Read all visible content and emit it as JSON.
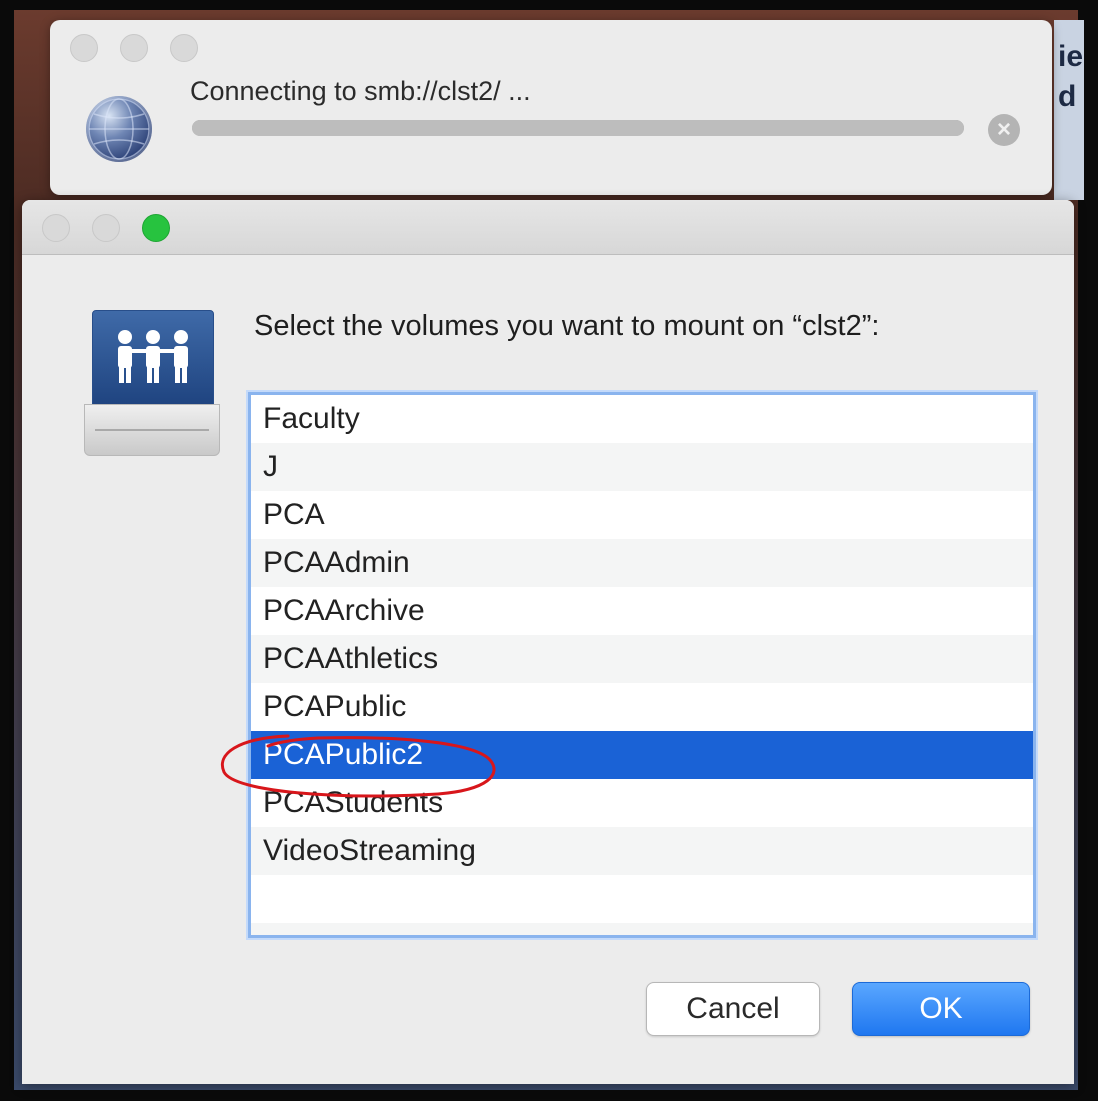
{
  "connect_window": {
    "status_text": "Connecting to smb://clst2/ ...",
    "progress": 1.0
  },
  "background": {
    "letters": [
      "ie",
      "d"
    ]
  },
  "dialog": {
    "prompt": "Select the volumes you want to mount on “clst2”:",
    "volumes": [
      {
        "label": "Faculty",
        "selected": false
      },
      {
        "label": "J",
        "selected": false
      },
      {
        "label": "PCA",
        "selected": false
      },
      {
        "label": "PCAAdmin",
        "selected": false
      },
      {
        "label": "PCAArchive",
        "selected": false
      },
      {
        "label": "PCAAthletics",
        "selected": false
      },
      {
        "label": "PCAPublic",
        "selected": false
      },
      {
        "label": "PCAPublic2",
        "selected": true
      },
      {
        "label": "PCAStudents",
        "selected": false
      },
      {
        "label": "VideoStreaming",
        "selected": false
      }
    ],
    "cancel_label": "Cancel",
    "ok_label": "OK"
  },
  "colors": {
    "selection": "#1a62d6",
    "ok_button": "#1f77f0",
    "annotation": "#d8161b",
    "zoom_button": "#27c33f"
  },
  "icons": [
    "globe-icon",
    "stop-icon",
    "server-icon"
  ]
}
